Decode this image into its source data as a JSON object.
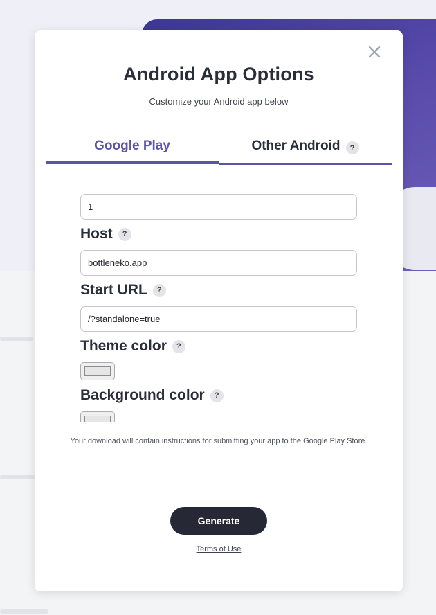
{
  "modal": {
    "title": "Android App Options",
    "subtitle": "Customize your Android app below",
    "close_icon": "close-icon"
  },
  "tabs": [
    {
      "label": "Google Play",
      "active": true
    },
    {
      "label": "Other Android",
      "active": false,
      "help": "?"
    }
  ],
  "form": {
    "first_field_value": "1",
    "host": {
      "label": "Host",
      "help": "?",
      "value": "bottleneko.app"
    },
    "start_url": {
      "label": "Start URL",
      "help": "?",
      "value": "/?standalone=true"
    },
    "theme_color": {
      "label": "Theme color",
      "help": "?"
    },
    "background_color": {
      "label": "Background color",
      "help": "?"
    }
  },
  "download_note": "Your download will contain instructions for submitting your app to the Google Play Store.",
  "generate_label": "Generate",
  "terms_label": "Terms of Use",
  "colors": {
    "accent": "#5b55a8",
    "button_dark": "#262836",
    "title_text": "#2a2d3a"
  }
}
